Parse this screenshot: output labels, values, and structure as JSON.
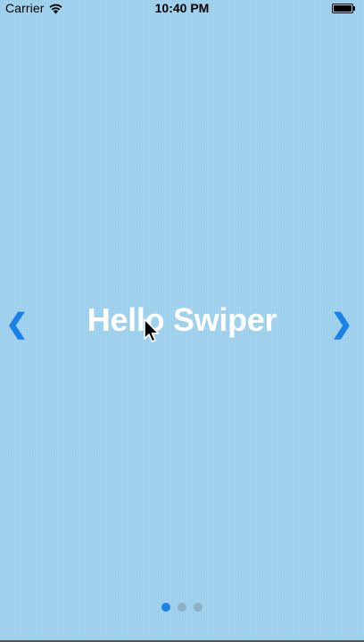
{
  "status_bar": {
    "carrier": "Carrier",
    "time": "10:40 PM",
    "icons": [
      "wifi-icon",
      "battery-icon"
    ]
  },
  "slider": {
    "title": "Hello Swiper",
    "prev_icon": "chevron-left-icon",
    "next_icon": "chevron-right-icon",
    "prev_glyph": "❮",
    "next_glyph": "❯",
    "pagination": {
      "count": 3,
      "active_index": 0
    }
  },
  "colors": {
    "background": "#9fd2ee",
    "accent": "#1a82e6",
    "text": "#ffffff",
    "inactive_bullet": "#8bb0c8"
  }
}
